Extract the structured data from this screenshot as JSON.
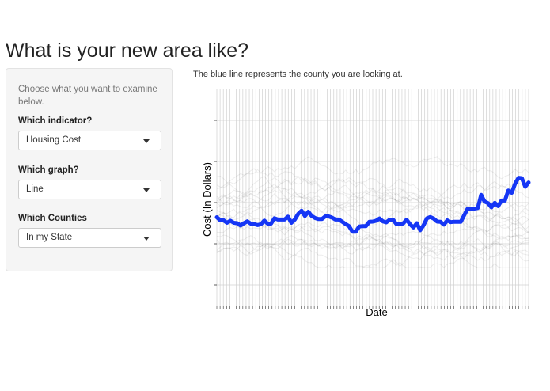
{
  "page": {
    "title": "What is your new area like?"
  },
  "sidebar": {
    "help_text": "Choose what you want to examine below.",
    "controls": [
      {
        "label": "Which indicator?",
        "value": "Housing Cost"
      },
      {
        "label": "Which graph?",
        "value": "Line"
      },
      {
        "label": "Which Counties",
        "value": "In my State"
      }
    ]
  },
  "main": {
    "caption": "The blue line represents the county you are looking at."
  },
  "colors": {
    "highlight": "#1536f5",
    "background_lines": "#000000",
    "grid": "#d0d0d0"
  },
  "chart_data": {
    "type": "line",
    "title": "",
    "xlabel": "Date",
    "ylabel": "Cost (In Dollars)",
    "grid": true,
    "series": [
      {
        "values": [
          32.5,
          31.0,
          31.0,
          29.8,
          30.8,
          29.8,
          29.6,
          28.5,
          29.6,
          30.5,
          29.4,
          29.2,
          28.7,
          29.1,
          30.9,
          29.4,
          29.4,
          32.0,
          31.4,
          31.4,
          31.4,
          32.8,
          29.8,
          31.4,
          34.1,
          35.7,
          33.1,
          35.2,
          33.1,
          32.1,
          31.6,
          31.6,
          32.9,
          32.9,
          32.3,
          31.4,
          31.4,
          30.3,
          29.2,
          28.2,
          25.5,
          25.5,
          28.0,
          28.2,
          28.2,
          30.3,
          30.4,
          30.8,
          31.9,
          30.5,
          30.0,
          31.3,
          31.3,
          29.1,
          29.1,
          29.5,
          31.3,
          29.1,
          27.5,
          29.6,
          26.2,
          28.6,
          32.0,
          32.6,
          31.8,
          30.4,
          30.3,
          28.9,
          31.0,
          30.1,
          30.3,
          30.3,
          30.3,
          33.5,
          36.7,
          36.7,
          36.7,
          37.0,
          43.4,
          40.1,
          39.4,
          37.3,
          39.5,
          37.9,
          40.6,
          40.6,
          45.5,
          44.4,
          48.8,
          51.7,
          51.5,
          47.3,
          49.4
        ]
      }
    ],
    "background_series_count": 20
  }
}
